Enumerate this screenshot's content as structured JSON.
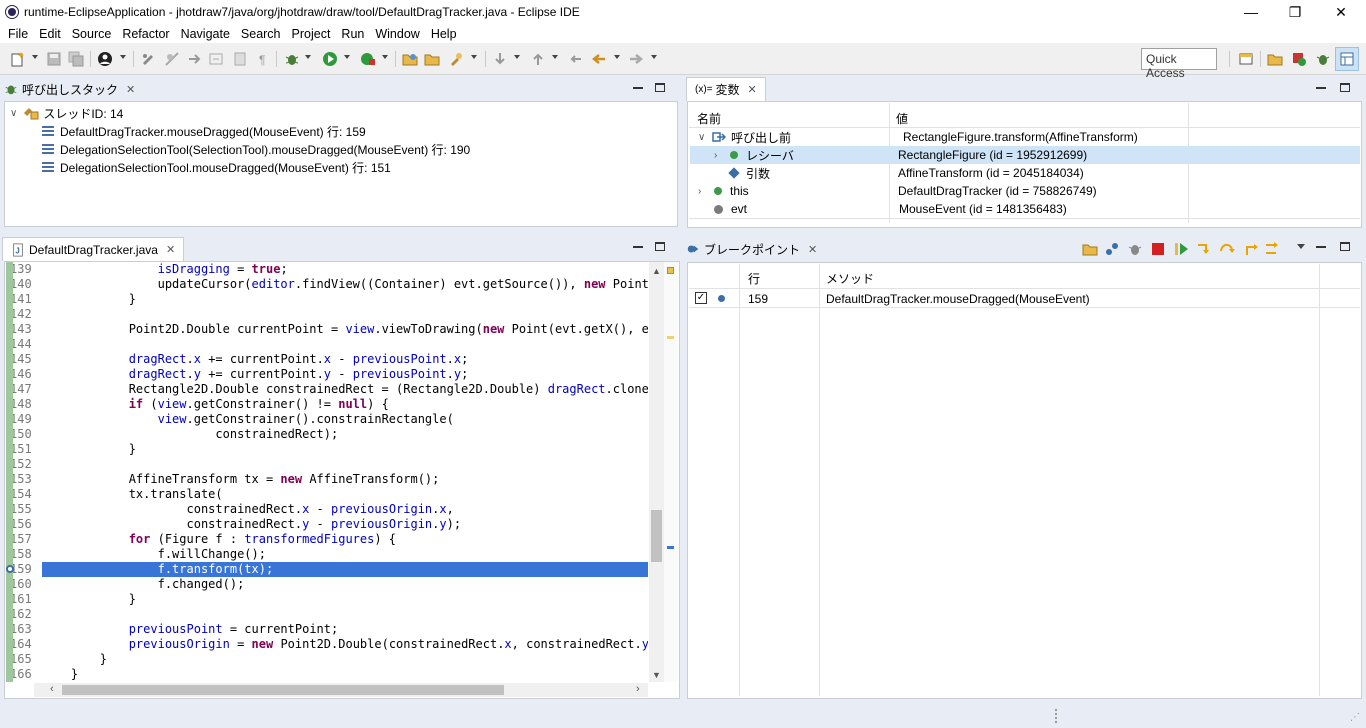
{
  "window": {
    "title": "runtime-EclipseApplication - jhotdraw7/java/org/jhotdraw/draw/tool/DefaultDragTracker.java - Eclipse IDE",
    "minimize": "—",
    "restore": "❐",
    "close": "✕"
  },
  "menu": [
    "File",
    "Edit",
    "Source",
    "Refactor",
    "Navigate",
    "Search",
    "Project",
    "Run",
    "Window",
    "Help"
  ],
  "quick_access": "Quick Access",
  "callstack": {
    "tab_label": "呼び出しスタック",
    "thread": "スレッドID: 14",
    "frames": [
      "DefaultDragTracker.mouseDragged(MouseEvent) 行: 159",
      "DelegationSelectionTool(SelectionTool).mouseDragged(MouseEvent) 行: 190",
      "DelegationSelectionTool.mouseDragged(MouseEvent) 行: 151"
    ]
  },
  "variables": {
    "tab_label": "変数",
    "tab_prefix": "(x)=",
    "col_name": "名前",
    "col_value": "値",
    "rows": [
      {
        "name": "呼び出し前",
        "value": "RectangleFigure.transform(AffineTransform)"
      },
      {
        "name": "レシーバ",
        "value": "RectangleFigure  (id = 1952912699)"
      },
      {
        "name": "引数",
        "value": "AffineTransform  (id = 2045184034)"
      },
      {
        "name": "this",
        "value": "DefaultDragTracker  (id = 758826749)"
      },
      {
        "name": "evt",
        "value": "MouseEvent  (id = 1481356483)"
      }
    ]
  },
  "editor": {
    "tab_label": "DefaultDragTracker.java",
    "line_numbers": [
      "139",
      "140",
      "141",
      "142",
      "143",
      "144",
      "145",
      "146",
      "147",
      "148",
      "149",
      "150",
      "151",
      "152",
      "153",
      "154",
      "155",
      "156",
      "157",
      "158",
      "159",
      "160",
      "161",
      "162",
      "163",
      "164",
      "165",
      "166"
    ]
  },
  "breakpoints": {
    "tab_label": "ブレークポイント",
    "col_line": "行",
    "col_method": "メソッド",
    "rows": [
      {
        "line": "159",
        "method": "DefaultDragTracker.mouseDragged(MouseEvent)"
      }
    ]
  },
  "colors": {
    "selection": "#3875d7",
    "keyword": "#7f0055",
    "field": "#0000c0",
    "row_highlight": "#cfe4f7"
  }
}
